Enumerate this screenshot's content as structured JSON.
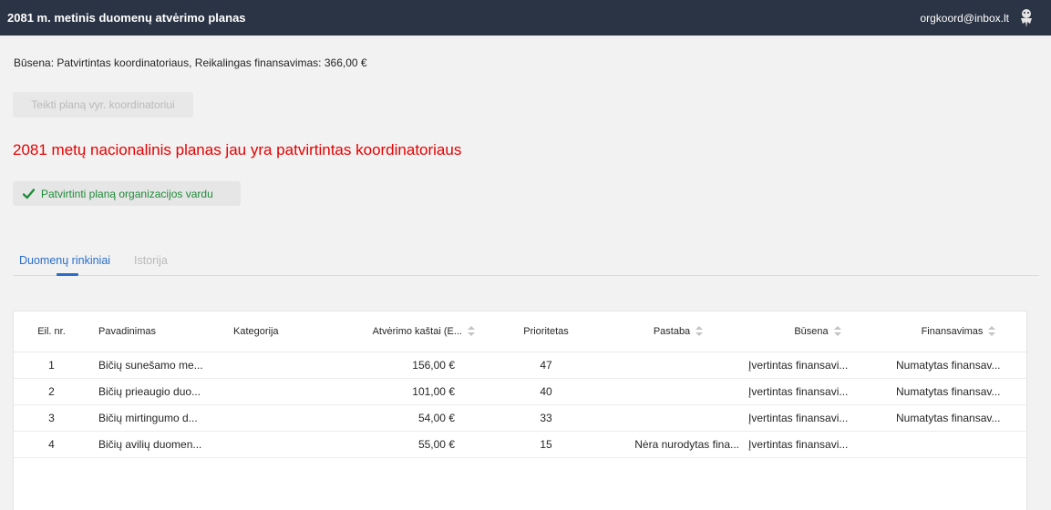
{
  "header": {
    "title": "2081 m. metinis duomenų atvėrimo planas",
    "user_email": "orgkoord@inbox.lt",
    "user_icon": "user-icon"
  },
  "status_line": "Būsena: Patvirtintas koordinatoriaus, Reikalingas finansavimas: 366,00 €",
  "submit_button": "Teikti planą vyr. koordinatoriui",
  "warning": "2081 metų nacionalinis planas jau yra patvirtintas koordinatoriaus",
  "approve_button": {
    "label": "Patvirtinti planą organizacijos vardu",
    "icon": "check-icon",
    "color": "#1f8a3a"
  },
  "tabs": [
    {
      "label": "Duomenų rinkiniai",
      "active": true
    },
    {
      "label": "Istorija",
      "active": false
    }
  ],
  "table": {
    "columns": [
      "Eil. nr.",
      "Pavadinimas",
      "Kategorija",
      "Atvėrimo kaštai (E...",
      "Prioritetas",
      "Pastaba",
      "Būsena",
      "Finansavimas"
    ],
    "rows": [
      {
        "nr": "1",
        "name": "Bičių sunešamo me...",
        "category": "",
        "cost": "156,00 €",
        "priority": "47",
        "note": "",
        "status": "Įvertintas finansavi...",
        "funding": "Numatytas finansav..."
      },
      {
        "nr": "2",
        "name": "Bičių prieaugio duo...",
        "category": "",
        "cost": "101,00 €",
        "priority": "40",
        "note": "",
        "status": "Įvertintas finansavi...",
        "funding": "Numatytas finansav..."
      },
      {
        "nr": "3",
        "name": "Bičių mirtingumo d...",
        "category": "",
        "cost": "54,00 €",
        "priority": "33",
        "note": "",
        "status": "Įvertintas finansavi...",
        "funding": "Numatytas finansav..."
      },
      {
        "nr": "4",
        "name": "Bičių avilių duomen...",
        "category": "",
        "cost": "55,00 €",
        "priority": "15",
        "note": "Nėra nurodytas fina...",
        "status": "Įvertintas finansavi...",
        "funding": ""
      }
    ]
  },
  "colors": {
    "topbar": "#2b3445",
    "accent": "#2a6dc9",
    "warning": "#e60000"
  }
}
